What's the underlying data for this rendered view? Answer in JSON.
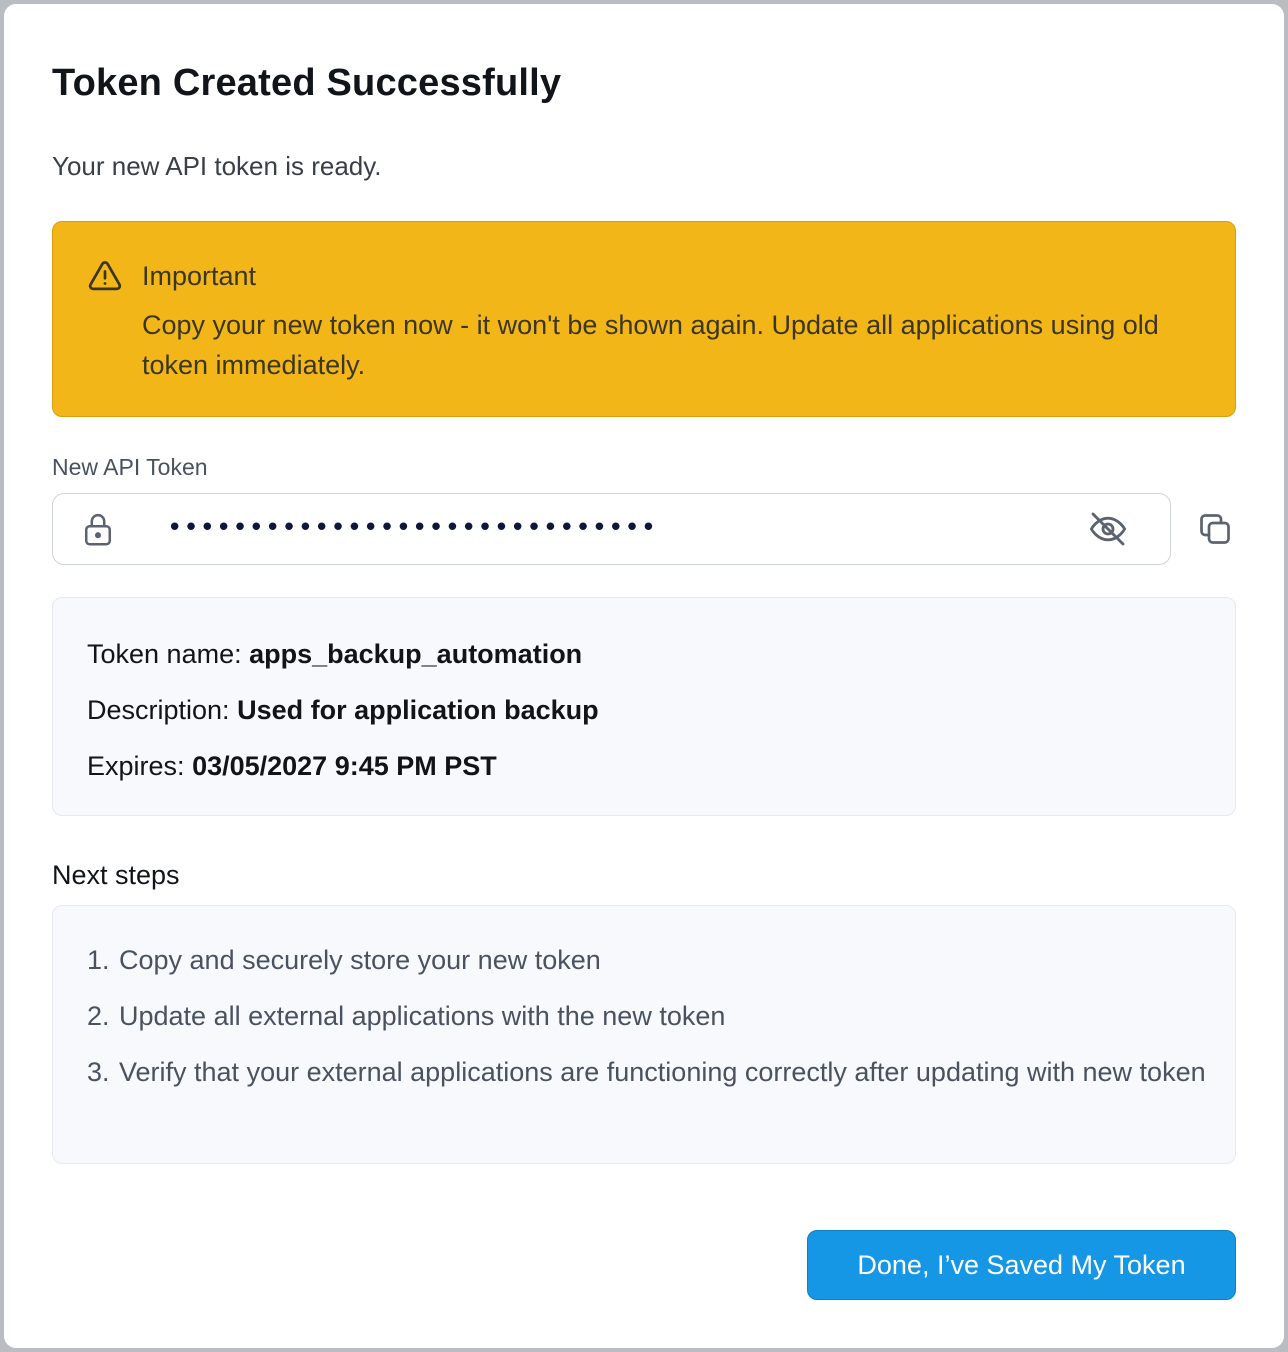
{
  "dialog": {
    "title": "Token Created Successfully",
    "subtitle": "Your new API token is ready."
  },
  "warning": {
    "icon": "warning-triangle-icon",
    "heading": "Important",
    "body": "Copy your new token now - it won't be shown again. Update all applications using old token immediately.",
    "background_color": "#f2b619"
  },
  "token_field": {
    "label": "New API Token",
    "masked_value": "••••••••••••••••••••••••••••••",
    "lock_icon": "lock-icon",
    "visibility_icon": "eye-off-icon",
    "copy_icon": "copy-icon"
  },
  "details": {
    "name_label": "Token name:",
    "name_value": "apps_backup_automation",
    "description_label": "Description:",
    "description_value": "Used for application backup",
    "expires_label": "Expires:",
    "expires_value": "03/05/2027 9:45 PM PST"
  },
  "next_steps": {
    "heading": "Next steps",
    "items": [
      {
        "number": "1.",
        "text": "Copy and securely store your new token"
      },
      {
        "number": "2.",
        "text": "Update all external applications with the new token"
      },
      {
        "number": "3.",
        "text": "Verify that your external applications are functioning correctly after updating with new token"
      }
    ]
  },
  "actions": {
    "done_label": "Done, I’ve Saved My Token",
    "accent_color": "#1597e5"
  }
}
